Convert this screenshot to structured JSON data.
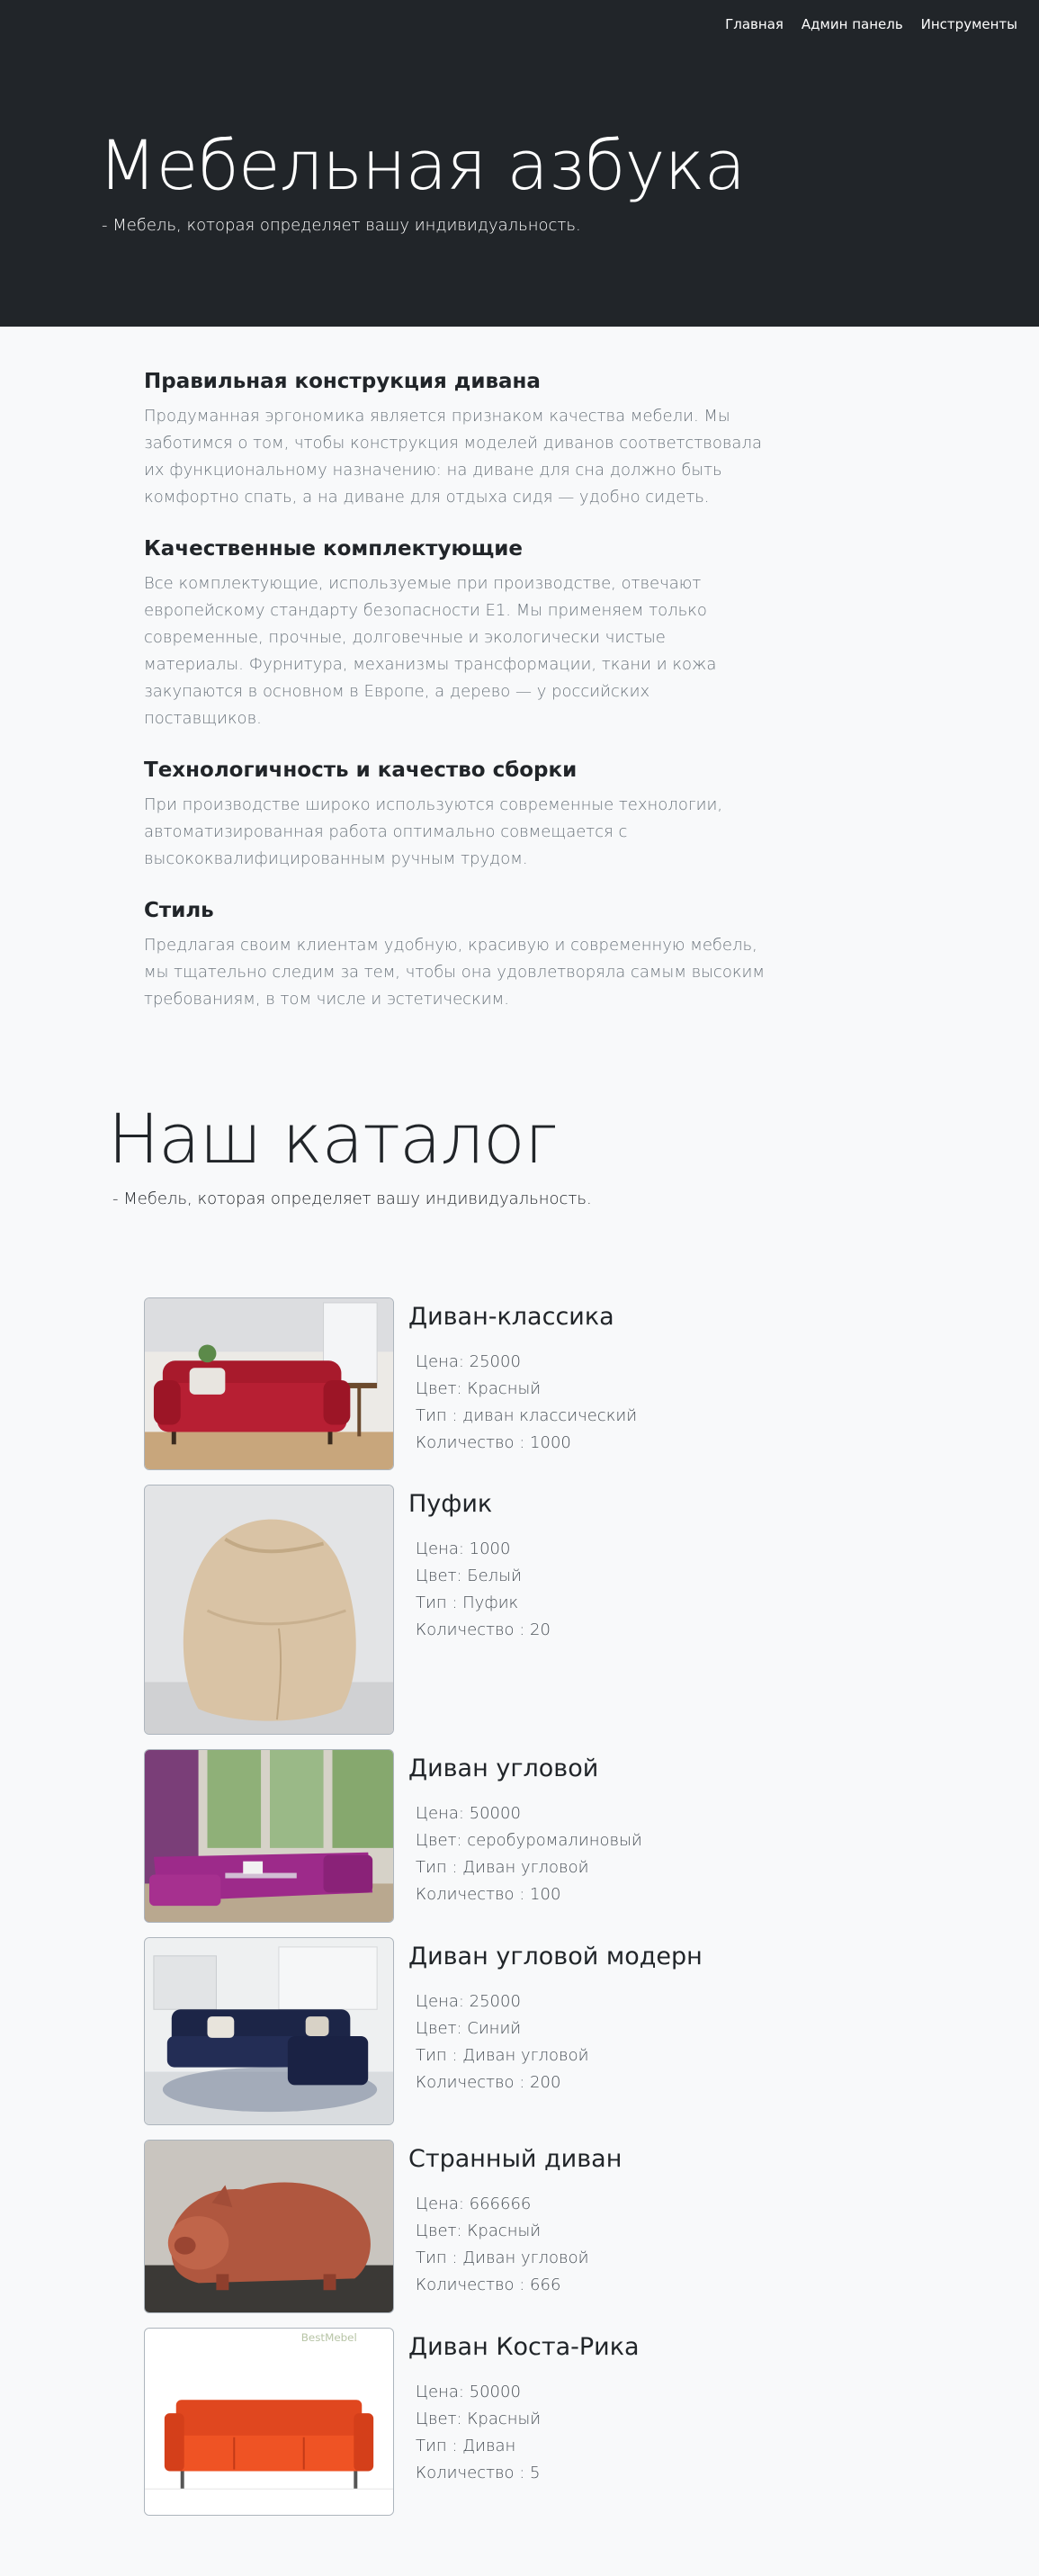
{
  "nav": {
    "items": [
      "Главная",
      "Админ панель",
      "Инструменты"
    ]
  },
  "hero": {
    "title": "Мебельная азбука",
    "subtitle": "- Мебель, которая определяет вашу индивидуальность."
  },
  "features": [
    {
      "title": "Правильная конструкция дивана",
      "text": "Продуманная эргономика является признаком качества мебели. Мы заботимся о том, чтобы конструкция моделей диванов соответствовала их функциональному назначению: на диване для сна должно быть комфортно спать, а на диване для отдыха сидя — удобно сидеть."
    },
    {
      "title": "Качественные комплектующие",
      "text": "Все комплектующие, используемые при производстве, отвечают европейскому стандарту безопасности Е1. Мы применяем только современные, прочные, долговечные и экологически чистые материалы. Фурнитура, механизмы трансформации, ткани и кожа закупаются в основном в Европе, а дерево — у российских поставщиков."
    },
    {
      "title": "Технологичность и качество сборки",
      "text": "При производстве широко используются современные технологии, автоматизированная работа оптимально совмещается с высококвалифицированным ручным трудом."
    },
    {
      "title": "Стиль",
      "text": "Предлагая своим клиентам удобную, красивую и современную мебель, мы тщательно следим за тем, чтобы она удовлетворяла самым высоким требованиям, в том числе и эстетическим."
    }
  ],
  "catalog": {
    "title": "Наш каталог",
    "subtitle": "- Мебель, которая определяет вашу индивидуальность.",
    "watermark": "BestMebel",
    "products": [
      {
        "name": "Диван-классика",
        "price": "Цена: 25000",
        "color": "Цвет: Красный",
        "type": "Тип : диван классический",
        "qty": "Количество : 1000",
        "image": "red-classic-sofa-photo"
      },
      {
        "name": "Пуфик",
        "price": "Цена: 1000",
        "color": "Цвет: Белый",
        "type": "Тип : Пуфик",
        "qty": "Количество : 20",
        "image": "beige-beanbag-photo"
      },
      {
        "name": "Диван угловой",
        "price": "Цена: 50000",
        "color": "Цвет: серобуромалиновый",
        "type": "Тип : Диван угловой",
        "qty": "Количество : 100",
        "image": "purple-corner-sofa-photo"
      },
      {
        "name": "Диван угловой модерн",
        "price": "Цена: 25000",
        "color": "Цвет: Синий",
        "type": "Тип : Диван угловой",
        "qty": "Количество : 200",
        "image": "navy-corner-sofa-photo"
      },
      {
        "name": "Странный диван",
        "price": "Цена: 666666",
        "color": "Цвет: Красный",
        "type": "Тип : Диван угловой",
        "qty": "Количество : 666",
        "image": "pig-shaped-sofa-photo"
      },
      {
        "name": "Диван Коста-Рика",
        "price": "Цена: 50000",
        "color": "Цвет: Красный",
        "type": "Тип : Диван",
        "qty": "Количество : 5",
        "image": "orange-sofa-photo"
      }
    ]
  }
}
